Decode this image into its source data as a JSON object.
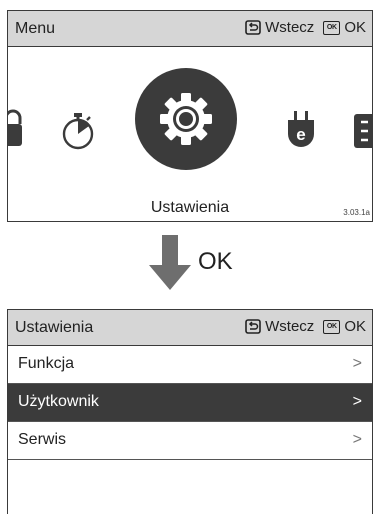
{
  "menu_screen": {
    "title": "Menu",
    "back_label": "Wstecz",
    "ok_icon_text": "OK",
    "ok_label": "OK",
    "carousel": {
      "items": [
        {
          "icon": "lock-icon"
        },
        {
          "icon": "stopwatch-icon"
        },
        {
          "icon": "gear-icon",
          "label": "Ustawienia",
          "selected": true
        },
        {
          "icon": "energy-plug-icon",
          "badge": "e"
        },
        {
          "icon": "next-menu-icon"
        }
      ],
      "selected_label": "Ustawienia",
      "version": "3.03.1a"
    }
  },
  "transition": {
    "label": "OK",
    "icon": "arrow-down-icon"
  },
  "settings_screen": {
    "title": "Ustawienia",
    "back_label": "Wstecz",
    "ok_icon_text": "OK",
    "ok_label": "OK",
    "items": [
      {
        "label": "Funkcja",
        "chevron": ">",
        "selected": false
      },
      {
        "label": "Użytkownik",
        "chevron": ">",
        "selected": true
      },
      {
        "label": "Serwis",
        "chevron": ">",
        "selected": false
      }
    ]
  },
  "colors": {
    "header_bg": "#d6d6d6",
    "selected_bg": "#3b3b3b",
    "border": "#3a3a3a",
    "arrow": "#6e6e6e"
  }
}
